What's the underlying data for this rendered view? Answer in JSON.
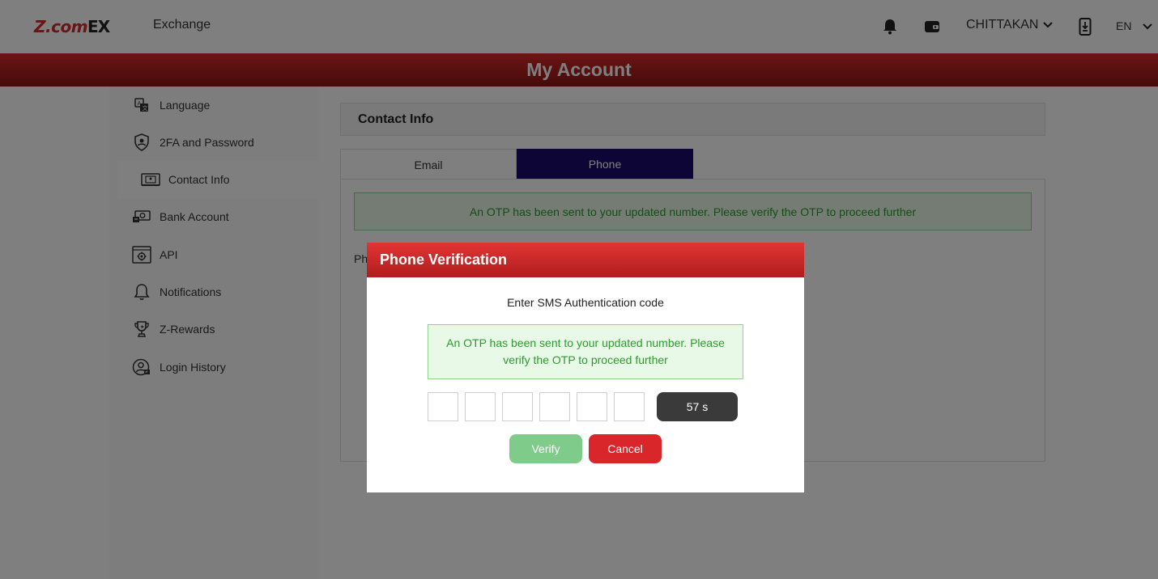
{
  "header": {
    "logo_z": "Z.com",
    "logo_ex": "EX",
    "brand_subtitle": "Exchange",
    "user_name": "CHITTAKAN",
    "language": "EN",
    "icons": [
      "bell-icon",
      "wallet-icon",
      "chevron-down-icon",
      "mobile-download-icon"
    ]
  },
  "banner": {
    "title": "My Account"
  },
  "sidebar": {
    "items": [
      {
        "label": "Language",
        "icon": "language-icon"
      },
      {
        "label": "2FA and Password",
        "icon": "shield-user-icon"
      },
      {
        "label": "Contact Info",
        "icon": "id-card-icon",
        "active": true
      },
      {
        "label": "Bank Account",
        "icon": "bank-money-icon"
      },
      {
        "label": "API",
        "icon": "api-gear-icon"
      },
      {
        "label": "Notifications",
        "icon": "bell-outline-icon"
      },
      {
        "label": "Z-Rewards",
        "icon": "trophy-icon"
      },
      {
        "label": "Login History",
        "icon": "user-history-icon"
      }
    ]
  },
  "contact": {
    "heading": "Contact Info",
    "tabs": [
      {
        "label": "Email",
        "active": false
      },
      {
        "label": "Phone",
        "active": true
      }
    ],
    "alert": "An OTP has been sent to your updated number. Please verify the OTP to proceed further",
    "phone_label_partial": "Ph"
  },
  "modal": {
    "title": "Phone Verification",
    "subtitle": "Enter SMS Authentication code",
    "alert": "An OTP has been sent to your updated number. Please verify the OTP to proceed further",
    "otp_digits": [
      "",
      "",
      "",
      "",
      "",
      ""
    ],
    "timer": "57 s",
    "verify_label": "Verify",
    "cancel_label": "Cancel"
  },
  "colors": {
    "brand_red": "#d42a2a",
    "active_tab": "#1a0a6b",
    "success_green": "#2e9a2e",
    "verify_green": "#7ecb8a",
    "cancel_red": "#d9262a"
  }
}
